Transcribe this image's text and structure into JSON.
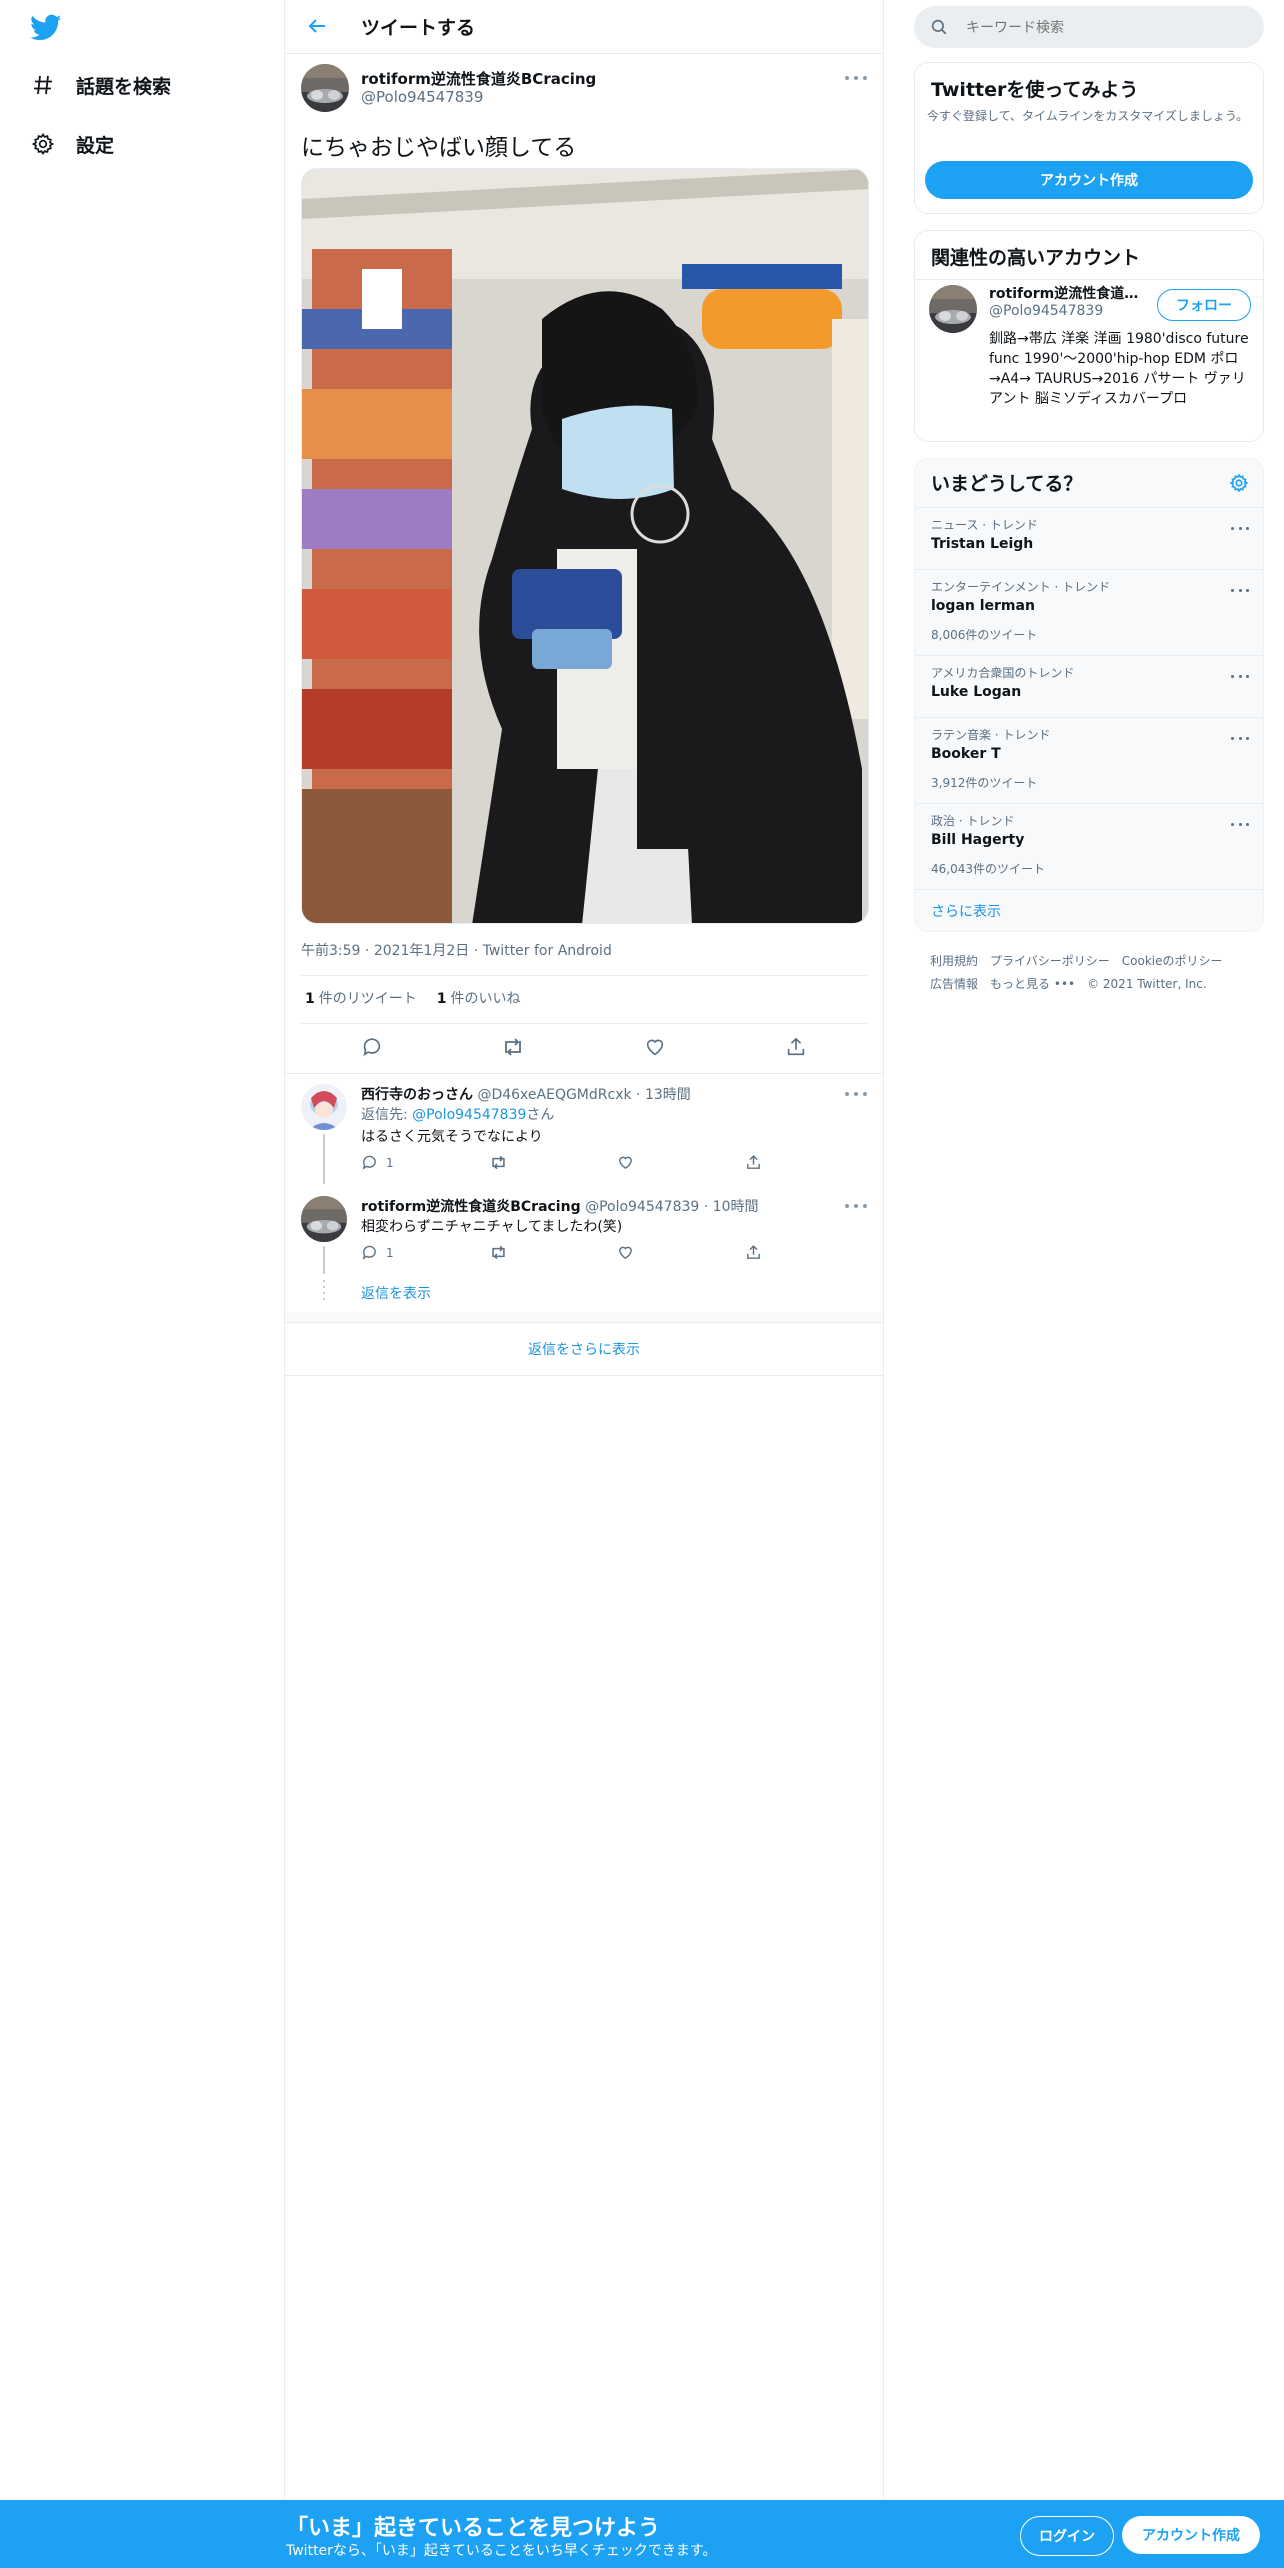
{
  "nav": {
    "explore_label": "話題を検索",
    "settings_label": "設定"
  },
  "header": {
    "title": "ツイートする"
  },
  "tweet": {
    "author_name": "rotiform逆流性食道炎BCracing",
    "author_handle": "@Polo94547839",
    "text": "にちゃおじやばい顔してる",
    "time": "午前3:59",
    "date": "2021年1月2日",
    "source": "Twitter for Android",
    "retweets_count": "1",
    "retweets_label": "件のリツイート",
    "likes_count": "1",
    "likes_label": "件のいいね"
  },
  "replies": [
    {
      "name": "西行寺のおっさん",
      "handle": "@D46xeAEQGMdRcxk",
      "time": "13時間",
      "reply_to_prefix": "返信先: ",
      "reply_to_handle": "@Polo94547839",
      "reply_to_suffix": "さん",
      "text": "はるさく元気そうでなにより",
      "reply_count": "1"
    },
    {
      "name": "rotiform逆流性食道炎BCracing",
      "handle": "@Polo94547839",
      "time": "10時間",
      "text": "相変わらずニチャニチャしてましたわ(笑)",
      "reply_count": "1"
    }
  ],
  "thread": {
    "show_replies": "返信を表示",
    "show_more_replies": "返信をさらに表示"
  },
  "search": {
    "placeholder": "キーワード検索"
  },
  "signup_card": {
    "title": "Twitterを使ってみよう",
    "description": "今すぐ登録して、タイムラインをカスタマイズしましょう。",
    "button": "アカウント作成"
  },
  "relevant": {
    "title": "関連性の高いアカウント",
    "name": "rotiform逆流性食道炎...",
    "handle": "@Polo94547839",
    "follow": "フォロー",
    "bio": "釧路→帯広 洋楽 洋画 1980'disco future func 1990'～2000'hip-hop EDM ポロ→A4→ TAURUS→2016 パサート ヴァリアント 脳ミソディスカバープロ"
  },
  "trends": {
    "title": "いまどうしてる？",
    "items": [
      {
        "category": "ニュース · トレンド",
        "name": "Tristan Leigh",
        "count": ""
      },
      {
        "category": "エンターテインメント · トレンド",
        "name": "logan lerman",
        "count": "8,006件のツイート"
      },
      {
        "category": "アメリカ合衆国のトレンド",
        "name": "Luke Logan",
        "count": ""
      },
      {
        "category": "ラテン音楽 · トレンド",
        "name": "Booker T",
        "count": "3,912件のツイート"
      },
      {
        "category": "政治 · トレンド",
        "name": "Bill Hagerty",
        "count": "46,043件のツイート"
      }
    ],
    "show_more": "さらに表示"
  },
  "footer": {
    "terms": "利用規約",
    "privacy": "プライバシーポリシー",
    "cookie": "Cookieのポリシー",
    "ads": "広告情報",
    "more": "もっと見る",
    "copyright": "© 2021 Twitter, Inc."
  },
  "bottom_bar": {
    "title": "「いま」起きていることを見つけよう",
    "subtitle": "Twitterなら、「いま」起きていることをいち早くチェックできます。",
    "login": "ログイン",
    "signup": "アカウント作成"
  },
  "colors": {
    "accent": "#1da1f2",
    "link": "#1b95e0",
    "secondary_text": "#5b7083",
    "border": "#e6ecf0"
  }
}
